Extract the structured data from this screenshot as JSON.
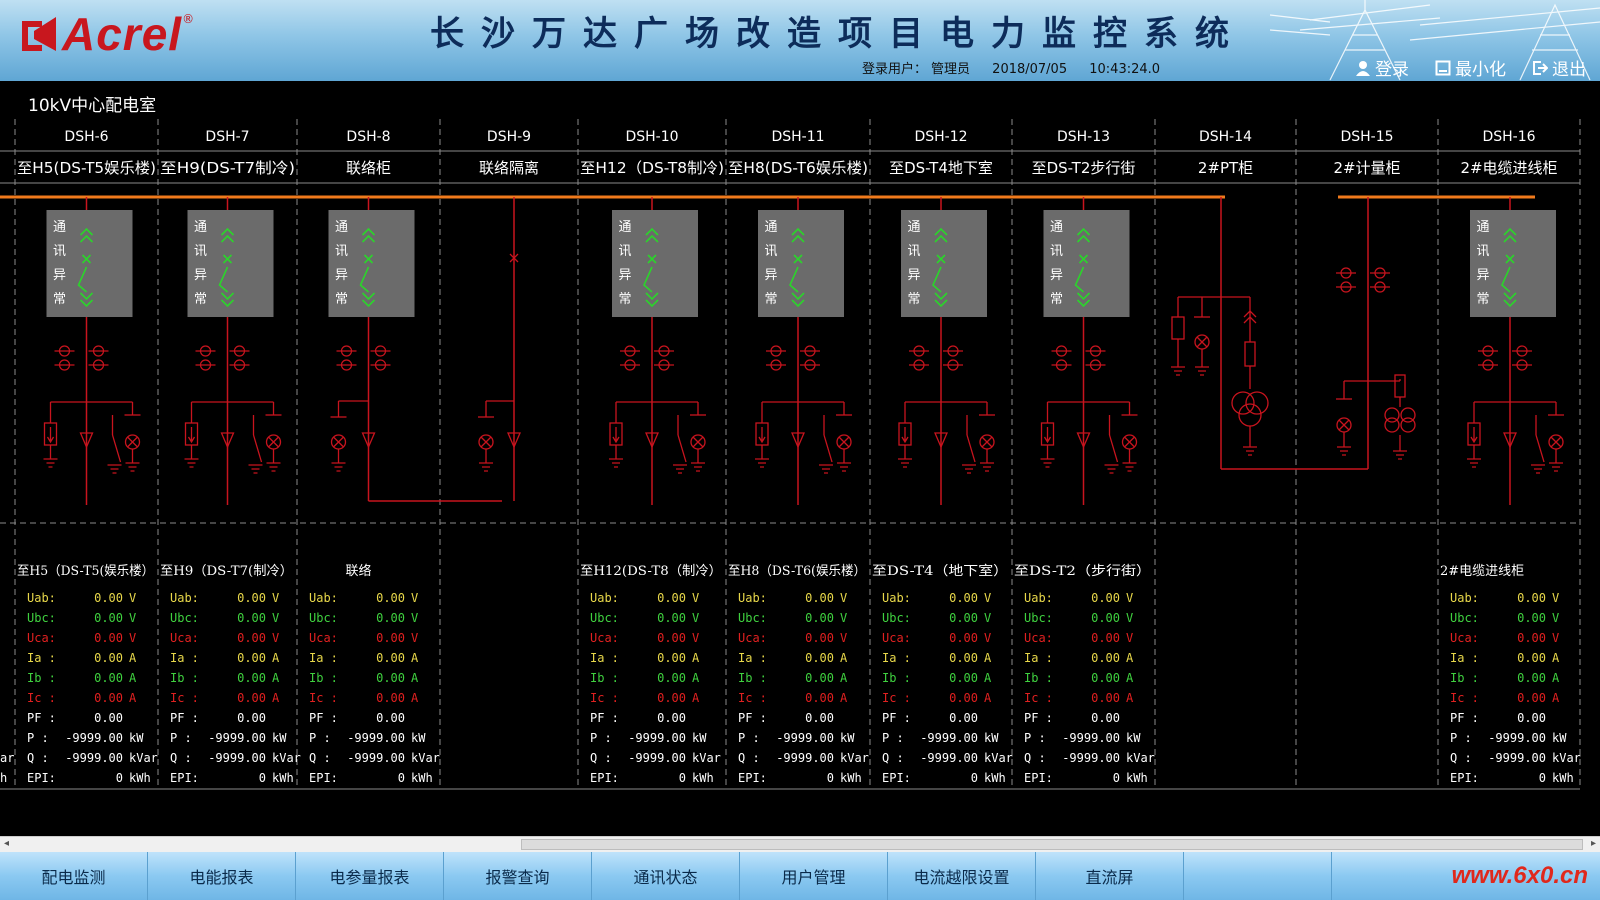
{
  "header": {
    "brand": "Acrel",
    "brand_mark": "®",
    "title": "长沙万达广场改造项目电力监控系统",
    "login_label": "登录用户：",
    "user": "管理员",
    "date": "2018/07/05",
    "time": "10:43:24.0",
    "buttons": [
      {
        "label": "登录",
        "icon": "user-icon"
      },
      {
        "label": "最小化",
        "icon": "minimize-icon"
      },
      {
        "label": "退出",
        "icon": "exit-icon"
      }
    ]
  },
  "room_title": "10kV中心配电室",
  "comm_error_label": [
    "通",
    "讯",
    "异",
    "常"
  ],
  "cabinets": [
    {
      "id": "DSH-6",
      "name": "至H5(DS-T5娱乐楼)",
      "meter_title": "至H5（DS-T5(娱乐楼）",
      "type": "feeder",
      "comm": true,
      "meter": true
    },
    {
      "id": "DSH-7",
      "name": "至H9(DS-T7制冷)",
      "meter_title": "至H9（DS-T7(制冷）",
      "type": "feeder",
      "comm": true,
      "meter": true
    },
    {
      "id": "DSH-8",
      "name": "联络柜",
      "meter_title": "联络",
      "type": "tie",
      "comm": true,
      "meter": true
    },
    {
      "id": "DSH-9",
      "name": "联络隔离",
      "meter_title": "",
      "type": "tie-isolate",
      "comm": false,
      "meter": false
    },
    {
      "id": "DSH-10",
      "name": "至H12（DS-T8制冷)",
      "meter_title": "至H12(DS-T8（制冷）",
      "type": "feeder",
      "comm": true,
      "meter": true
    },
    {
      "id": "DSH-11",
      "name": "至H8(DS-T6娱乐楼)",
      "meter_title": "至H8（DS-T6(娱乐楼）",
      "type": "feeder",
      "comm": true,
      "meter": true
    },
    {
      "id": "DSH-12",
      "name": "至DS-T4地下室",
      "meter_title": "至DS-T4（地下室）",
      "type": "feeder",
      "comm": true,
      "meter": true
    },
    {
      "id": "DSH-13",
      "name": "至DS-T2步行街",
      "meter_title": "至DS-T2（步行街）",
      "type": "feeder",
      "comm": true,
      "meter": true
    },
    {
      "id": "DSH-14",
      "name": "2#PT柜",
      "meter_title": "",
      "type": "pt",
      "comm": false,
      "meter": false
    },
    {
      "id": "DSH-15",
      "name": "2#计量柜",
      "meter_title": "",
      "type": "metering",
      "comm": false,
      "meter": false
    },
    {
      "id": "DSH-16",
      "name": "2#电缆进线柜",
      "meter_title": "2#电缆进线柜",
      "type": "incoming",
      "comm": true,
      "meter": true
    }
  ],
  "meter_rows": [
    {
      "label": "Uab:",
      "value": "0.00",
      "unit": "V",
      "color": "#e8d84a"
    },
    {
      "label": "Ubc:",
      "value": "0.00",
      "unit": "V",
      "color": "#3fd13f"
    },
    {
      "label": "Uca:",
      "value": "0.00",
      "unit": "V",
      "color": "#e02020"
    },
    {
      "label": "Ia :",
      "value": "0.00",
      "unit": "A",
      "color": "#e8d84a"
    },
    {
      "label": "Ib :",
      "value": "0.00",
      "unit": "A",
      "color": "#3fd13f"
    },
    {
      "label": "Ic :",
      "value": "0.00",
      "unit": "A",
      "color": "#e02020"
    },
    {
      "label": "PF :",
      "value": "0.00",
      "unit": "",
      "color": "#ffffff"
    },
    {
      "label": "P  :",
      "value": "-9999.00",
      "unit": "kW",
      "color": "#ffffff"
    },
    {
      "label": "Q  :",
      "value": "-9999.00",
      "unit": "kVar",
      "color": "#ffffff"
    },
    {
      "label": "EPI:",
      "value": "0",
      "unit": "kWh",
      "color": "#ffffff"
    }
  ],
  "edge_meter_fragments": [
    "ar",
    "h"
  ],
  "bottom_nav": [
    "配电监测",
    "电能报表",
    "电参量报表",
    "报警查询",
    "通讯状态",
    "用户管理",
    "电流越限设置",
    "直流屏",
    "",
    ""
  ],
  "watermark": "www.6x0.cn",
  "colors": {
    "busbar": "#f07a1c",
    "line": "#c8141e",
    "switch_on": "#2bd42b",
    "grid": "#8a8a8a"
  }
}
